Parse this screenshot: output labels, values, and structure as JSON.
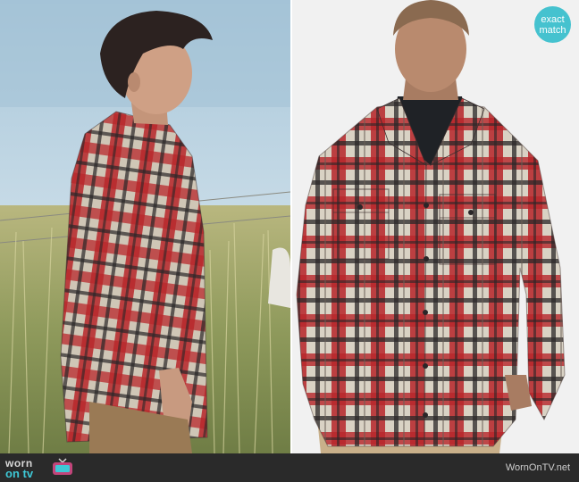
{
  "badge": {
    "line1": "exact",
    "line2": "match"
  },
  "footer": {
    "logo_top": "worn",
    "logo_bottom": "on tv",
    "watermark": "WornOnTV.net"
  },
  "colors": {
    "badge": "#45c2cf",
    "footer_bar": "#2a2a2a",
    "plaid_red": "#b8262a",
    "plaid_cream": "#d9d2c4",
    "plaid_dark": "#2a2628"
  },
  "images": {
    "left": "photo-actor-in-field",
    "right": "photo-model-studio"
  }
}
